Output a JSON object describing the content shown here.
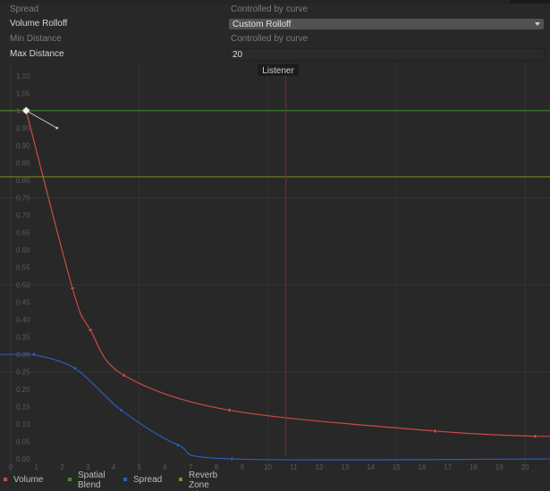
{
  "properties": {
    "spread": {
      "label": "Spread",
      "value": "Controlled by curve"
    },
    "volume_rolloff": {
      "label": "Volume Rolloff",
      "value": "Custom Rolloff"
    },
    "min_distance": {
      "label": "Min Distance",
      "value": "Controlled by curve"
    },
    "max_distance": {
      "label": "Max Distance",
      "value": "20"
    }
  },
  "graph": {
    "marker_label": "Listener",
    "listener_x": 10.7,
    "y_ticks": [
      "1.10",
      "1.05",
      "1.00",
      "0.95",
      "0.90",
      "0.85",
      "0.80",
      "0.75",
      "0.70",
      "0.65",
      "0.60",
      "0.55",
      "0.50",
      "0.45",
      "0.40",
      "0.35",
      "0.30",
      "0.25",
      "0.20",
      "0.15",
      "0.10",
      "0.05",
      "0.00"
    ],
    "x_ticks": [
      "0",
      "1",
      "2",
      "3",
      "4",
      "5",
      "6",
      "7",
      "8",
      "9",
      "10",
      "11",
      "12",
      "13",
      "14",
      "15",
      "16",
      "17",
      "18",
      "19",
      "20"
    ],
    "colors": {
      "volume": "#c94c43",
      "spatial_blend": "#3f8f2f",
      "spread": "#2b5fbf",
      "reverb_zone_mix": "#8c8a20",
      "listener": "#8c2525",
      "background": "#282828",
      "grid": "#333333"
    }
  },
  "chart_data": {
    "type": "line",
    "xlim": [
      0,
      20.8
    ],
    "ylim": [
      -0.005,
      1.11
    ],
    "series": [
      {
        "name": "Volume",
        "points": [
          [
            0.6,
            1.0
          ],
          [
            2.4,
            0.49
          ],
          [
            3.1,
            0.37
          ],
          [
            4.4,
            0.24
          ],
          [
            8.5,
            0.14
          ],
          [
            16.5,
            0.08
          ],
          [
            20.4,
            0.065
          ]
        ]
      },
      {
        "name": "Spatial Blend",
        "points": [
          [
            0,
            1.0
          ],
          [
            20.8,
            1.0
          ]
        ]
      },
      {
        "name": "Spread",
        "points": [
          [
            0.9,
            0.3
          ],
          [
            2.5,
            0.26
          ],
          [
            4.3,
            0.14
          ],
          [
            6.5,
            0.04
          ],
          [
            8.6,
            0.0
          ],
          [
            20.8,
            0.0
          ]
        ]
      },
      {
        "name": "Reverb Zone Mix",
        "points": [
          [
            0,
            0.81
          ],
          [
            20.8,
            0.81
          ]
        ]
      }
    ]
  },
  "legend": [
    {
      "key": "volume",
      "label": "Volume"
    },
    {
      "key": "spatial_blend",
      "label": "Spatial\nBlend"
    },
    {
      "key": "spread",
      "label": "Spread"
    },
    {
      "key": "reverb_zone_mix",
      "label": "Reverb\nZone Mix"
    }
  ]
}
